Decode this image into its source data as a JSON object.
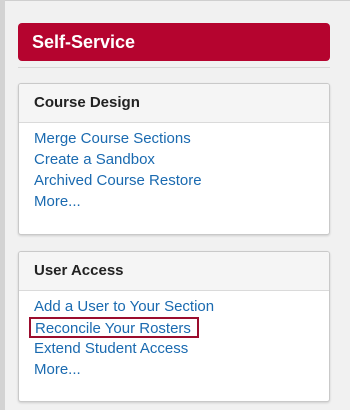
{
  "header": {
    "title": "Self-Service",
    "color": "#b5042f"
  },
  "panels": [
    {
      "title": "Course Design",
      "links": [
        "Merge Course Sections",
        "Create a Sandbox",
        "Archived Course Restore",
        "More..."
      ]
    },
    {
      "title": "User Access",
      "links": [
        "Add a User to Your Section",
        "Reconcile Your Rosters",
        "Extend Student Access",
        "More..."
      ],
      "highlighted_link": "Reconcile Your Rosters",
      "highlight_color": "#9b0d2e"
    }
  ],
  "link_color": "#1a6ab0"
}
